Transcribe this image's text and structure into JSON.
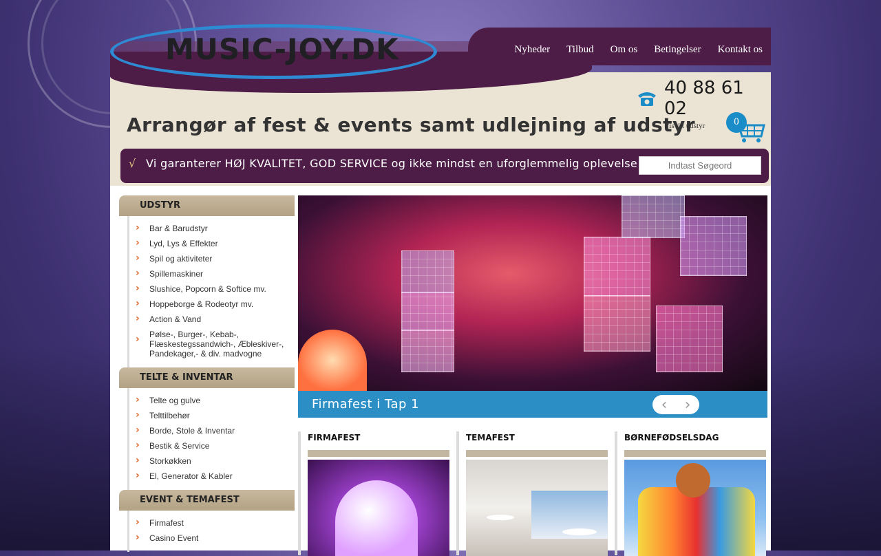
{
  "logo": {
    "text": "MUSIC-JOY.DK"
  },
  "nav": {
    "items": [
      "Nyheder",
      "Tilbud",
      "Om os",
      "Betingelser",
      "Kontakt os"
    ]
  },
  "phone": {
    "number": "40 88 61 02",
    "icon": "phone-icon"
  },
  "tagline": "Arrangør af fest & events samt udlejning af udstyr",
  "cart": {
    "link_label": "Vis dit udstyr",
    "count": "0",
    "icon": "cart-icon"
  },
  "banner": {
    "check": "√",
    "text": "Vi garanterer HØJ KVALITET, GOD SERVICE og ikke mindst en uforglemmelig oplevelse"
  },
  "search": {
    "placeholder": "Indtast Søgeord"
  },
  "sidebar": {
    "sections": [
      {
        "title": "UDSTYR",
        "items": [
          "Bar & Barudstyr",
          "Lyd, Lys & Effekter",
          "Spil og aktiviteter",
          "Spillemaskiner",
          "Slushice, Popcorn & Softice mv.",
          "Hoppeborge & Rodeotyr mv.",
          "Action & Vand",
          "Pølse-, Burger-, Kebab-, Flæskestegssandwich-, Æbleskiver-, Pandekager,- & div. madvogne"
        ]
      },
      {
        "title": "TELTE & INVENTAR",
        "items": [
          "Telte og gulve",
          "Telttilbehør",
          "Borde, Stole & Inventar",
          "Bestik & Service",
          "Storkøkken",
          "El, Generator & Kabler"
        ]
      },
      {
        "title": "EVENT & TEMAFEST",
        "items": [
          "Firmafest",
          "Casino Event"
        ]
      }
    ]
  },
  "slider": {
    "caption": "Firmafest i Tap 1",
    "prev": "‹",
    "next": "›"
  },
  "boxes": [
    {
      "title": "FIRMAFEST"
    },
    {
      "title": "TEMAFEST"
    },
    {
      "title": "BØRNEFØDSELSDAG"
    }
  ],
  "colors": {
    "accent_purple": "#4d1d47",
    "accent_blue": "#2b8fc6",
    "tan": "#c3b7a2",
    "chevron_orange": "#e06020"
  }
}
